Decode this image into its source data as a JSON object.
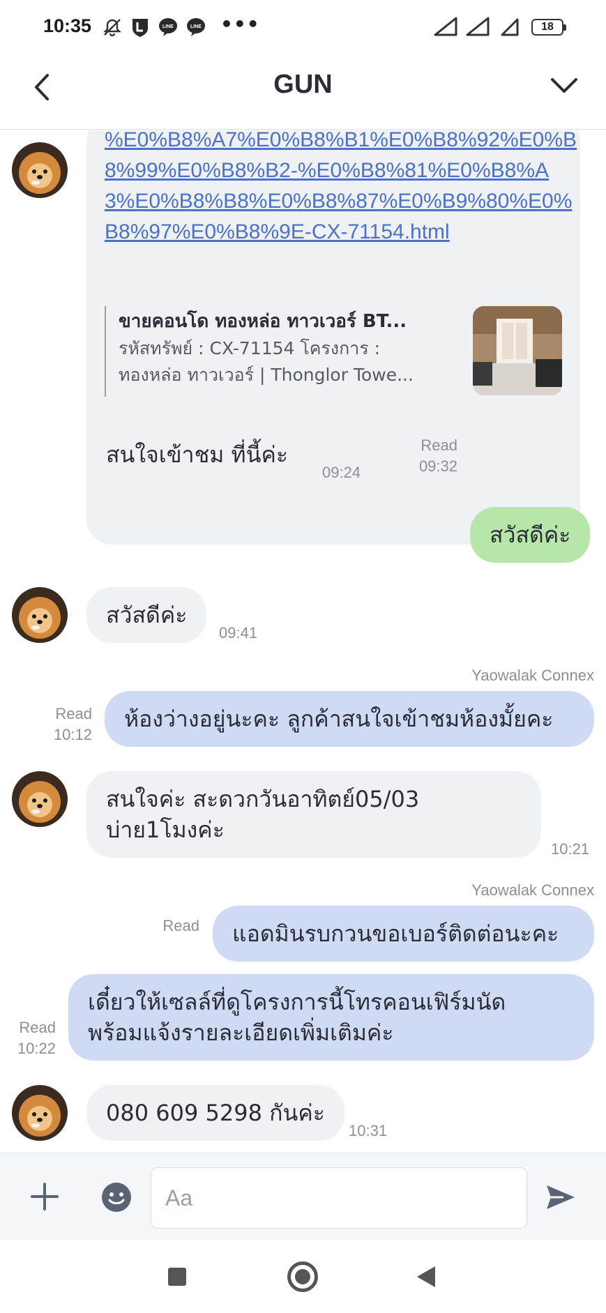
{
  "status_bar": {
    "time": "10:35",
    "dots": "•••",
    "battery": "18"
  },
  "header": {
    "title": "GUN"
  },
  "link_message": {
    "url_text": "%E0%B8%A7%E0%B8%B1%E0%B8%92%E0%B8%99%E0%B8%B2-%E0%B8%81%E0%B8%A3%E0%B8%B8%E0%B8%87%E0%B9%80%E0%B8%97%E0%B8%9E-CX-71154.html",
    "preview_title": "ขายคอนโด ทองหล่อ ทาวเวอร์ BT...",
    "preview_desc_1": "รหัสทรัพย์ : CX-71154 โครงการ :",
    "preview_desc_2": "ทองหล่อ ทาวเวอร์ | Thonglor Towe..."
  },
  "messages": [
    {
      "id": "m1",
      "text": "สนใจเข้าชม ที่นี้ค่ะ",
      "time": "09:24"
    },
    {
      "id": "m2",
      "text": "สวัสดีค่ะ",
      "read": "Read",
      "time": "09:32"
    },
    {
      "id": "m3",
      "text": "สวัสดีค่ะ",
      "time": "09:41"
    },
    {
      "id": "m4",
      "sender": "Yaowalak Connex",
      "text": "ห้องว่างอยู่นะคะ ลูกค้าสนใจเข้าชมห้องมั้ยคะ",
      "read": "Read",
      "time": "10:12"
    },
    {
      "id": "m5",
      "line1": "สนใจค่ะ สะดวกวันอาทิตย์05/03",
      "line2": "บ่าย1โมงค่ะ",
      "time": "10:21"
    },
    {
      "id": "m6",
      "sender": "Yaowalak Connex",
      "text": "แอดมินรบกวนขอเบอร์ติดต่อนะคะ",
      "read": "Read"
    },
    {
      "id": "m7",
      "line1": "เดี๋ยวให้เซลล์ที่ดูโครงการนี้โทรคอนเฟิร์มนัด",
      "line2": "พร้อมแจ้งรายละเอียดเพิ่มเติมค่ะ",
      "read": "Read",
      "time": "10:22"
    },
    {
      "id": "m8",
      "text": "080 609 5298 กันค่ะ",
      "time": "10:31"
    }
  ],
  "input_bar": {
    "placeholder": "Aa"
  },
  "colors": {
    "incoming": "#f0f1f4",
    "outgoing_green": "#b7e7a8",
    "outgoing_blue": "#cfdaf4",
    "link": "#4a72c9"
  }
}
